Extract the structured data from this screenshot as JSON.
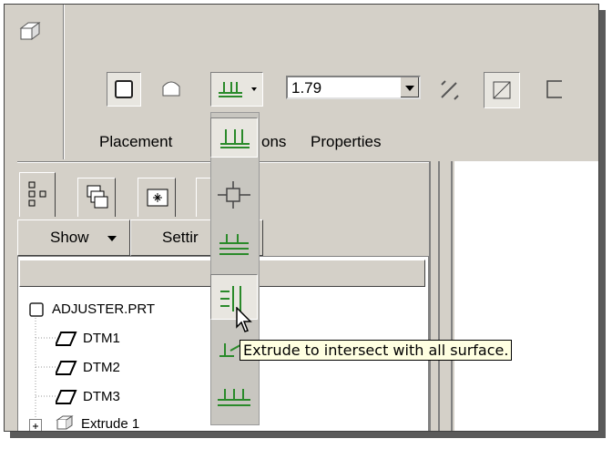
{
  "dashboard": {
    "depth_value": "1.79"
  },
  "tabs": {
    "placement": "Placement",
    "options_partial": "ons",
    "properties": "Properties"
  },
  "model_tree": {
    "show_label": "Show",
    "settings_partial": "Settir",
    "items": [
      {
        "label": "ADJUSTER.PRT",
        "icon": "part-icon"
      },
      {
        "label": "DTM1",
        "icon": "datum-plane-icon"
      },
      {
        "label": "DTM2",
        "icon": "datum-plane-icon"
      },
      {
        "label": "DTM3",
        "icon": "datum-plane-icon"
      },
      {
        "label": "Extrude 1",
        "icon": "extrude-feature-icon"
      }
    ]
  },
  "depth_options": [
    {
      "icon": "blind-depth-icon"
    },
    {
      "icon": "symmetric-depth-icon"
    },
    {
      "icon": "through-next-icon"
    },
    {
      "icon": "through-all-icon"
    },
    {
      "icon": "to-selected-icon"
    },
    {
      "icon": "to-surface-icon"
    }
  ],
  "tooltip": "Extrude to intersect with all surface."
}
